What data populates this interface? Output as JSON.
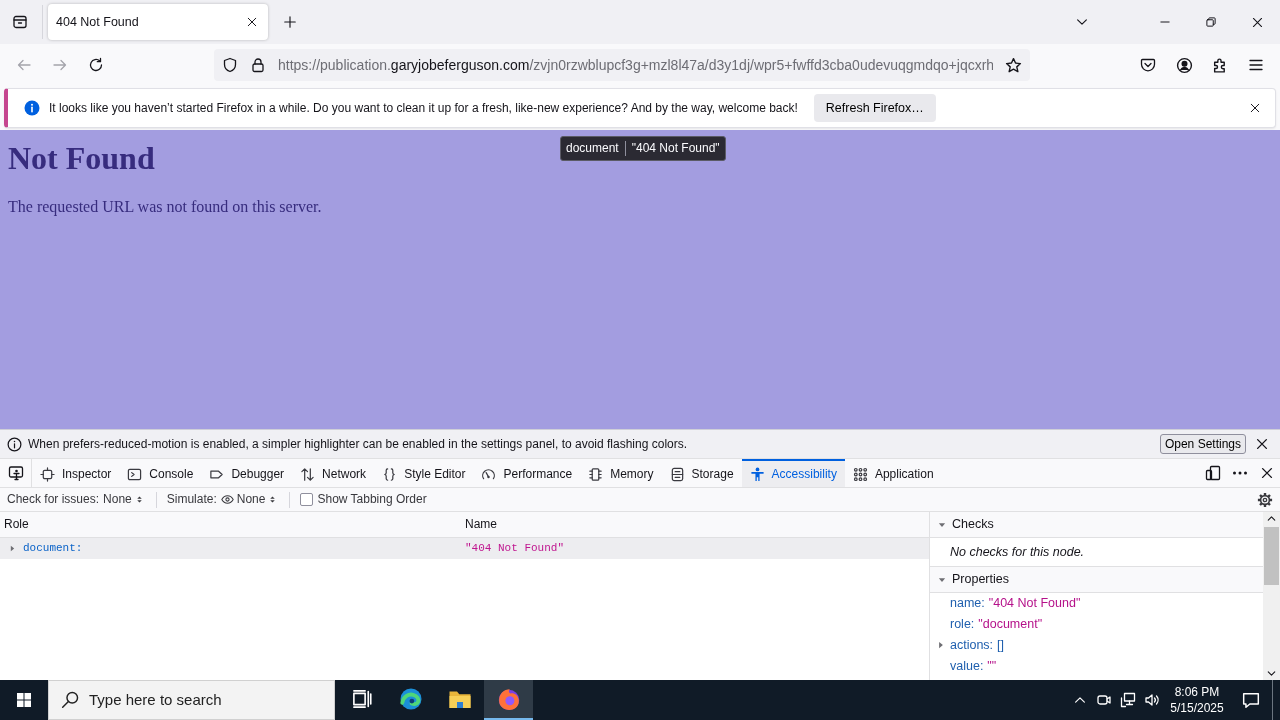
{
  "browser_tabs": [
    {
      "title": "404 Not Found",
      "selected": true
    }
  ],
  "address_bar": {
    "url_prefix": "https://publication.",
    "url_domain": "garyjobeferguson.com",
    "url_path": "/zvjn0rzwblupcf3g+mzl8l47a/d3y1dj/wpr5+fwffd3cba0udevuqgmdqo+jqcxrh"
  },
  "notification": {
    "message": "It looks like you haven’t started Firefox in a while. Do you want to clean it up for a fresh, like-new experience? And by the way, welcome back!",
    "button": "Refresh Firefox…"
  },
  "page": {
    "heading": "Not Found",
    "text": "The requested URL was not found on this server.",
    "highlight_tooltip": {
      "role": "document",
      "name": "\"404 Not Found\""
    }
  },
  "devtools": {
    "notice": {
      "message": "When prefers-reduced-motion is enabled, a simpler highlighter can be enabled in the settings panel, to avoid flashing colors.",
      "button": "Open Settings"
    },
    "tabs": [
      {
        "label": "Inspector",
        "selected": false
      },
      {
        "label": "Console",
        "selected": false
      },
      {
        "label": "Debugger",
        "selected": false
      },
      {
        "label": "Network",
        "selected": false
      },
      {
        "label": "Style Editor",
        "selected": false
      },
      {
        "label": "Performance",
        "selected": false
      },
      {
        "label": "Memory",
        "selected": false
      },
      {
        "label": "Storage",
        "selected": false
      },
      {
        "label": "Accessibility",
        "selected": true
      },
      {
        "label": "Application",
        "selected": false
      }
    ],
    "toolbar": {
      "check_label": "Check for issues:",
      "check_value": "None",
      "simulate_label": "Simulate:",
      "simulate_value": "None",
      "tabbing_label": "Show Tabbing Order",
      "tabbing_checked": false
    },
    "tree": {
      "columns": [
        "Role",
        "Name"
      ],
      "rows": [
        {
          "role": "document:",
          "name": "\"404 Not Found\"",
          "selected": true,
          "expanded": false
        }
      ]
    },
    "sidebar": {
      "sections": [
        {
          "kind": "note",
          "title": "Checks",
          "expanded": true,
          "note": "No checks for this node."
        },
        {
          "kind": "properties",
          "title": "Properties",
          "expanded": true,
          "properties": [
            {
              "kind": "string",
              "key": "name:",
              "value": "\"404 Not Found\""
            },
            {
              "kind": "string",
              "key": "role:",
              "value": "\"document\""
            },
            {
              "kind": "array",
              "key": "actions:",
              "value": "[]",
              "expanded": false
            },
            {
              "kind": "string",
              "key": "value:",
              "value": "\"\""
            }
          ]
        }
      ]
    }
  },
  "taskbar": {
    "search_placeholder": "Type here to search",
    "apps": [
      {
        "selected": false
      },
      {
        "selected": false
      },
      {
        "selected": false
      },
      {
        "selected": true
      }
    ],
    "time": "8:06 PM",
    "date": "5/15/2025"
  }
}
